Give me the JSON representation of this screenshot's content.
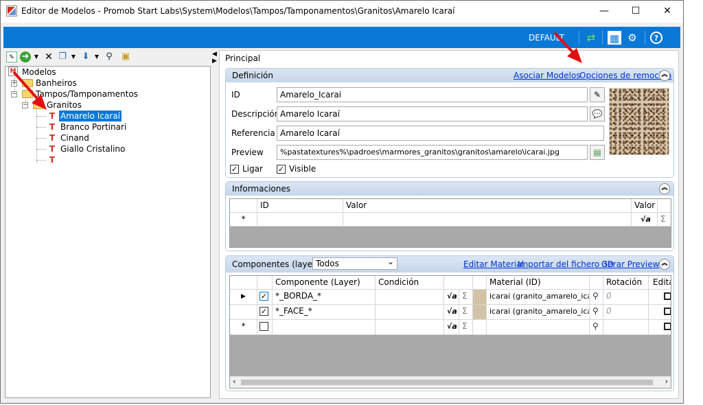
{
  "window": {
    "title": "Editor de Modelos - Promob Start Labs\\System\\Modelos\\Tampos/Tamponamentos\\Granitos\\Amarelo Icaraí",
    "min": "—",
    "max": "☐",
    "close": "✕"
  },
  "bluebar": {
    "default_label": "DEFAULT",
    "refresh_icon": "⇄",
    "layout_icon": "▦",
    "settings_icon": "⚙",
    "help_icon": "?"
  },
  "tree": {
    "root": "Modelos",
    "items": [
      {
        "label": "Banheiros",
        "type": "folder"
      },
      {
        "label": "Tampos/Tamponamentos",
        "type": "folder"
      },
      {
        "label": "Granitos",
        "type": "folder"
      },
      {
        "label": "Amarelo Icaraí",
        "type": "model",
        "selected": true
      },
      {
        "label": "Branco Portinari",
        "type": "model"
      },
      {
        "label": "Cinand",
        "type": "model"
      },
      {
        "label": "Giallo Cristalino",
        "type": "model"
      },
      {
        "label": "",
        "type": "model"
      }
    ]
  },
  "main": {
    "tab": "Principal",
    "definicion": {
      "title": "Definición",
      "link_asociar": "Asociar Modelos",
      "link_opciones": "Opciones de remoción",
      "id_label": "ID",
      "id_value": "Amarelo_Icarai",
      "desc_label": "Descripción",
      "desc_value": "Amarelo Icaraí",
      "ref_label": "Referencia",
      "ref_value": "Amarelo Icaraí",
      "preview_label": "Preview",
      "preview_value": "%pastatextures%\\padroes\\marmores_granitos\\granitos\\amarelo\\icarai.jpg",
      "ligar_label": "Ligar",
      "visible_label": "Visible"
    },
    "informaciones": {
      "title": "Informaciones",
      "col_id": "ID",
      "col_valor": "Valor",
      "col_valor2": "Valor",
      "newrow": "*"
    },
    "componentes": {
      "title": "Componentes (layers)",
      "dropdown": "Todos",
      "link_editar": "Editar Material",
      "link_importar": "Importar del fichero 3D",
      "link_gerar": "Gerar Preview",
      "headers": {
        "componente": "Componente (Layer)",
        "condicion": "Condición",
        "material": "Material (ID)",
        "rotacion": "Rotación",
        "editar": "Editar"
      },
      "rows": [
        {
          "marker": "▶",
          "checked": "✓",
          "layer": "*_BORDA_*",
          "material": "icarai (granito_amarelo_icarai)",
          "rot": "0"
        },
        {
          "marker": "",
          "checked": "✓",
          "layer": "*_FACE_*",
          "material": "icarai (granito_amarelo_icarai)",
          "rot": "0"
        },
        {
          "marker": "*",
          "checked": "",
          "layer": "",
          "material": "",
          "rot": ""
        }
      ]
    }
  }
}
